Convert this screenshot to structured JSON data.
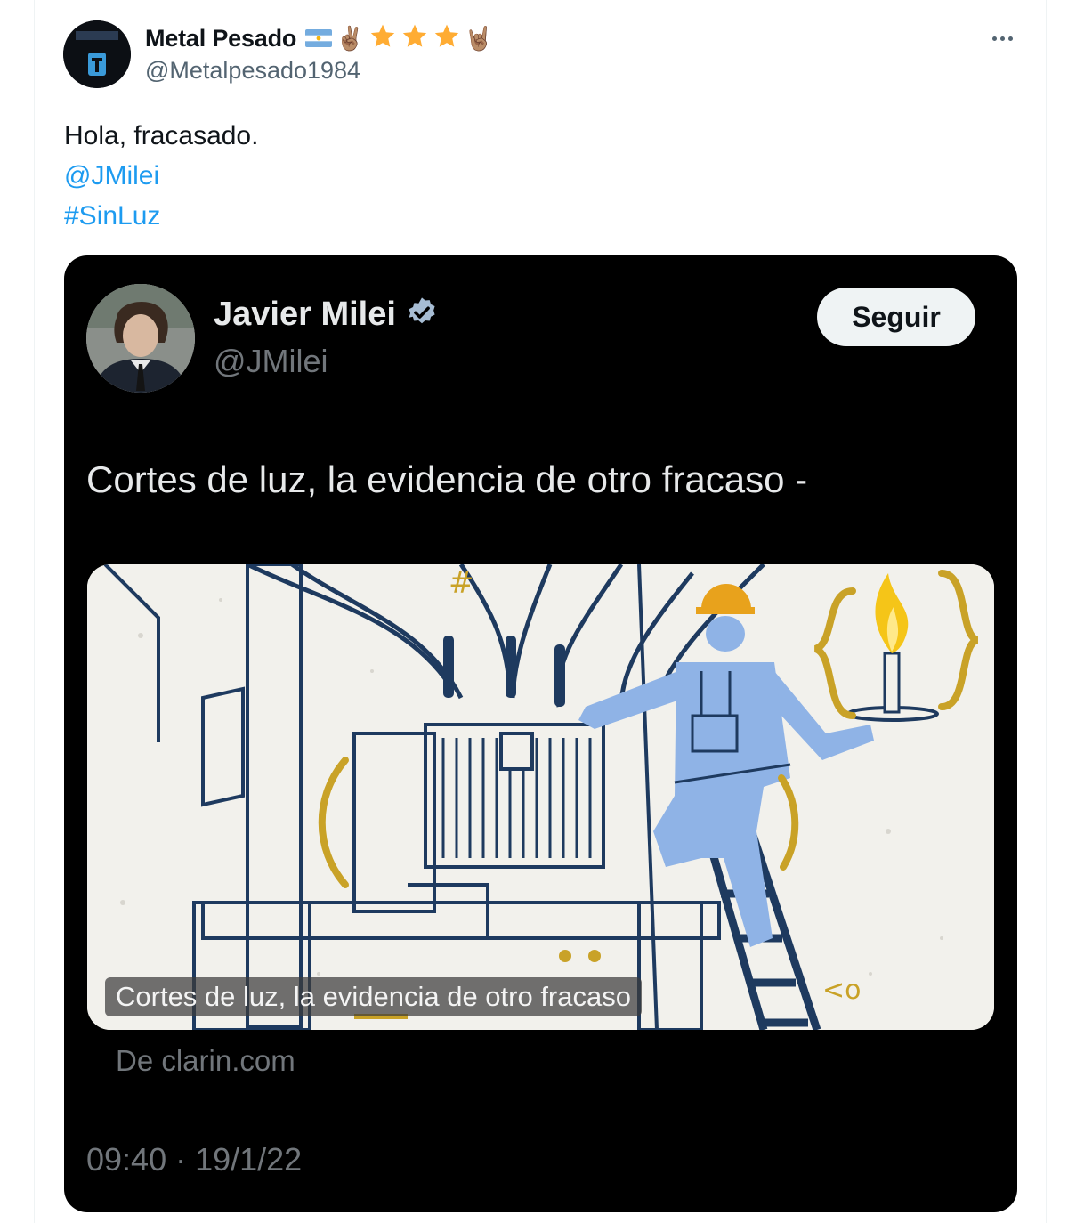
{
  "tweet": {
    "author": {
      "display_name": "Metal Pesado",
      "badges": [
        "🇦🇷",
        "✌🏽",
        "⭐",
        "⭐",
        "⭐",
        "🤘🏽"
      ],
      "handle": "@Metalpesado1984",
      "avatar_icon": "profile-avatar"
    },
    "more_icon": "more-options-icon",
    "text": "Hola, fracasado.",
    "mention": "@JMilei",
    "hashtag": "#SinLuz"
  },
  "embedded": {
    "author": {
      "display_name": "Javier Milei",
      "verified_icon": "verified-badge-icon",
      "handle": "@JMilei"
    },
    "follow_label": "Seguir",
    "text": "Cortes de luz, la evidencia de otro fracaso -",
    "media": {
      "description_icon": "electrician-illustration",
      "caption": "Cortes de luz, la evidencia de otro fracaso"
    },
    "source": "De clarin.com",
    "timestamp": "09:40 · 19/1/22"
  },
  "colors": {
    "link": "#1d9bf0",
    "embed_background": "#000000",
    "illustration_navy": "#1e3a5f",
    "illustration_blue": "#8fb3e6",
    "illustration_gold": "#c9a227"
  }
}
